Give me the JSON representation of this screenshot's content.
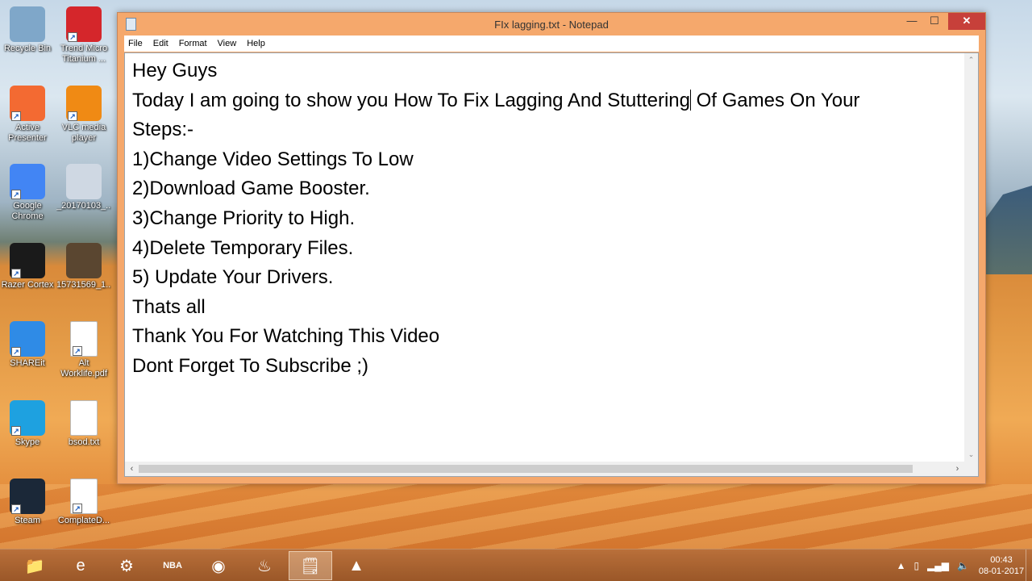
{
  "window": {
    "title": "FIx lagging.txt - Notepad",
    "minimize": "—",
    "maximize": "☐",
    "close": "✕"
  },
  "menu": [
    "File",
    "Edit",
    "Format",
    "View",
    "Help"
  ],
  "document": {
    "lines": [
      "Hey Guys",
      "Today I am going to show you How To Fix Lagging And Stuttering",
      "Steps:-",
      "1)Change Video Settings To Low",
      "2)Download Game Booster.",
      "3)Change Priority to High.",
      "4)Delete Temporary Files.",
      "5) Update Your Drivers.",
      "Thats all",
      "Thank You For Watching This Video",
      "Dont Forget To Subscribe ;)"
    ],
    "line2_after_caret": " Of Games On Your"
  },
  "desktop_icons": [
    {
      "label": "Recycle Bin",
      "icon": "recycle-bin-icon",
      "color": "#7fa7c9"
    },
    {
      "label": "Trend Micro\nTitanium ...",
      "icon": "trend-micro-icon",
      "color": "#d5262b"
    },
    {
      "label": "Active\nPresenter",
      "icon": "active-presenter-icon",
      "color": "#f36a32"
    },
    {
      "label": "VLC media\nplayer",
      "icon": "vlc-icon",
      "color": "#f08a14"
    },
    {
      "label": "Google\nChrome",
      "icon": "chrome-icon",
      "color": "#4285f4"
    },
    {
      "label": "_20170103_...",
      "icon": "screenshot-file-icon",
      "color": "#cfd8e3"
    },
    {
      "label": "Razer Cortex",
      "icon": "razer-cortex-icon",
      "color": "#1a1a1a"
    },
    {
      "label": "15731569_1...",
      "icon": "image-file-icon",
      "color": "#5a4630"
    },
    {
      "label": "SHAREit",
      "icon": "shareit-icon",
      "color": "#2f8be6"
    },
    {
      "label": "Alt\nWorklife.pdf",
      "icon": "pdf-icon",
      "color": "#ffffff"
    },
    {
      "label": "Skype",
      "icon": "skype-icon",
      "color": "#1ea1e0"
    },
    {
      "label": "bsod.txt",
      "icon": "text-file-icon",
      "color": "#ffffff"
    },
    {
      "label": "Steam",
      "icon": "steam-icon",
      "color": "#1b2838"
    },
    {
      "label": "ComplateD...",
      "icon": "pdf-icon",
      "color": "#ffffff"
    }
  ],
  "taskbar": {
    "apps": [
      {
        "name": "file-explorer-icon",
        "glyph": "📁"
      },
      {
        "name": "internet-explorer-icon",
        "glyph": "e"
      },
      {
        "name": "control-panel-icon",
        "glyph": "⚙"
      },
      {
        "name": "nba2k17-icon",
        "glyph": "NBA"
      },
      {
        "name": "chrome-icon",
        "glyph": "◉"
      },
      {
        "name": "steam-icon",
        "glyph": "♨"
      },
      {
        "name": "notepad-icon",
        "glyph": "🗒"
      },
      {
        "name": "vlc-icon",
        "glyph": "▲"
      }
    ],
    "tray": {
      "up_arrow": "▲",
      "clock_time": "00:43",
      "clock_date": "08-01-2017"
    }
  }
}
